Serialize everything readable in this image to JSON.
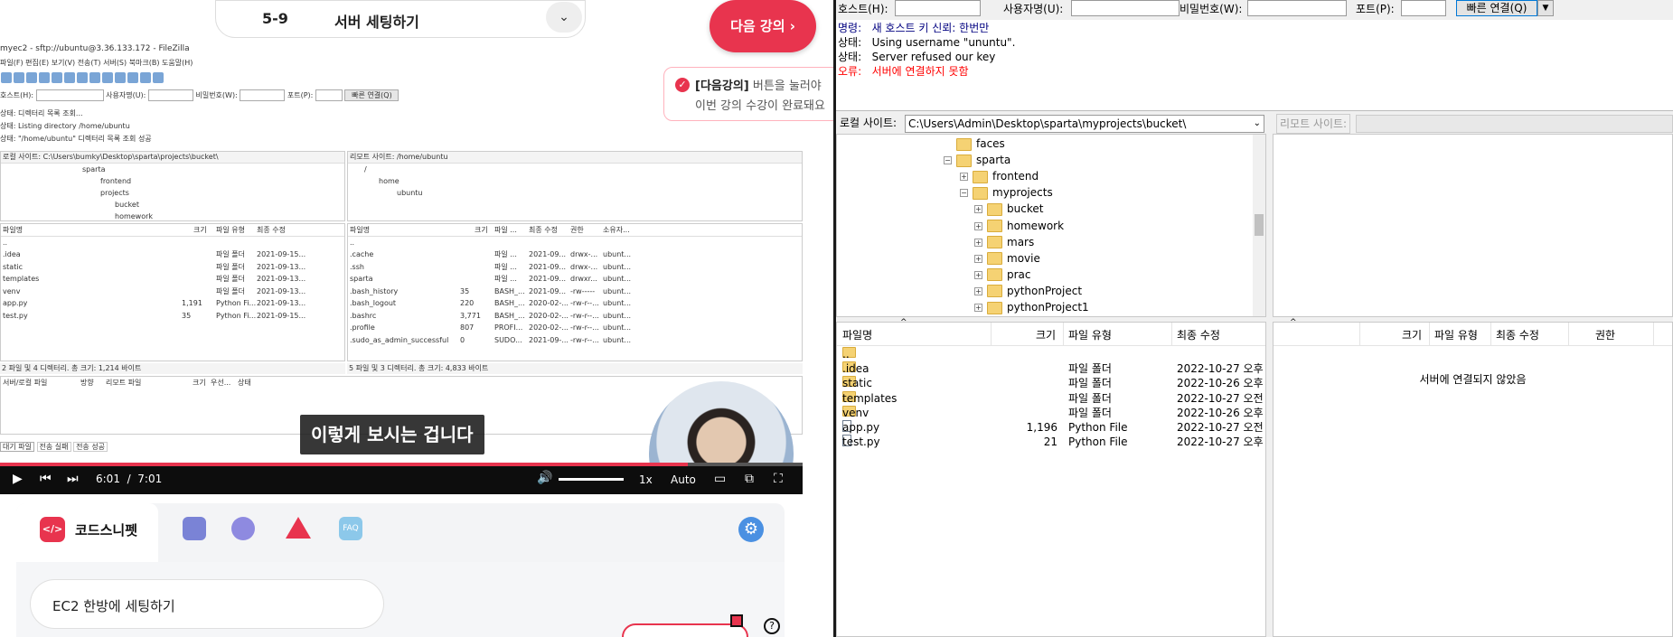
{
  "lecture": {
    "number": "5-9",
    "title": "서버 세팅하기",
    "next_button": "다음 강의",
    "toast_line1_bold": "[다음강의]",
    "toast_line1_rest": " 버튼을 눌러야",
    "toast_line2": "이번 강의 수강이 완료돼요"
  },
  "video": {
    "subtitle": "이렇게 보시는 겁니다",
    "current_time": "6:01",
    "separator": "/",
    "duration": "7:01",
    "progress_fraction": 0.857,
    "speed": "1x",
    "quality": "Auto"
  },
  "small_fz": {
    "title": "myec2 - sftp://ubuntu@3.36.133.172 - FileZilla",
    "menu": [
      "파일(F)",
      "편집(E)",
      "보기(V)",
      "전송(T)",
      "서버(S)",
      "북마크(B)",
      "도움말(H)"
    ],
    "qc_host": "호스트(H):",
    "qc_user": "사용자명(U):",
    "qc_pass": "비밀번호(W):",
    "qc_port": "포트(P):",
    "qc_connect": "빠른 연결(Q)",
    "log": [
      {
        "label": "상태:",
        "text": "디렉터리 목록 조회..."
      },
      {
        "label": "상태:",
        "text": "Listing directory /home/ubuntu"
      },
      {
        "label": "상태:",
        "text": "\"/home/ubuntu\" 디렉터리 목록 조회 성공"
      }
    ],
    "local_site_label": "로컬 사이트:",
    "local_site_path": "C:\\Users\\bumky\\Desktop\\sparta\\projects\\bucket\\",
    "remote_site_label": "리모트 사이트:",
    "remote_site_path": "/home/ubuntu",
    "local_tree": [
      "sparta",
      "frontend",
      "projects",
      "bucket",
      "homework"
    ],
    "remote_tree": [
      "/",
      "home",
      "ubuntu"
    ],
    "local_headers": [
      "파일명",
      "크기",
      "파일 유형",
      "최종 수정"
    ],
    "local_files": [
      {
        "name": "..",
        "size": "",
        "type": "",
        "date": ""
      },
      {
        "name": ".idea",
        "size": "",
        "type": "파일 폴더",
        "date": "2021-09-15..."
      },
      {
        "name": "static",
        "size": "",
        "type": "파일 폴더",
        "date": "2021-09-13..."
      },
      {
        "name": "templates",
        "size": "",
        "type": "파일 폴더",
        "date": "2021-09-13..."
      },
      {
        "name": "venv",
        "size": "",
        "type": "파일 폴더",
        "date": "2021-09-13..."
      },
      {
        "name": "app.py",
        "size": "1,191",
        "type": "Python Fi...",
        "date": "2021-09-13..."
      },
      {
        "name": "test.py",
        "size": "35",
        "type": "Python Fi...",
        "date": "2021-09-15..."
      }
    ],
    "remote_headers": [
      "파일명",
      "크기",
      "파일 ...",
      "최종 수정",
      "권한",
      "소유자..."
    ],
    "remote_files": [
      {
        "name": "..",
        "size": "",
        "type": "",
        "date": "",
        "perm": "",
        "owner": ""
      },
      {
        "name": ".cache",
        "size": "",
        "type": "파일 ...",
        "date": "2021-09...",
        "perm": "drwx-...",
        "owner": "ubunt..."
      },
      {
        "name": ".ssh",
        "size": "",
        "type": "파일 ...",
        "date": "2021-09...",
        "perm": "drwx-...",
        "owner": "ubunt..."
      },
      {
        "name": "sparta",
        "size": "",
        "type": "파일 ...",
        "date": "2021-09...",
        "perm": "drwxr...",
        "owner": "ubunt..."
      },
      {
        "name": ".bash_history",
        "size": "35",
        "type": "BASH_...",
        "date": "2021-09...",
        "perm": "-rw-----",
        "owner": "ubunt..."
      },
      {
        "name": ".bash_logout",
        "size": "220",
        "type": "BASH_...",
        "date": "2020-02-...",
        "perm": "-rw-r--...",
        "owner": "ubunt..."
      },
      {
        "name": ".bashrc",
        "size": "3,771",
        "type": "BASH_...",
        "date": "2020-02-...",
        "perm": "-rw-r--...",
        "owner": "ubunt..."
      },
      {
        "name": ".profile",
        "size": "807",
        "type": "PROFI...",
        "date": "2020-02-...",
        "perm": "-rw-r--...",
        "owner": "ubunt..."
      },
      {
        "name": ".sudo_as_admin_successful",
        "size": "0",
        "type": "SUDO...",
        "date": "2021-09-...",
        "perm": "-rw-r--...",
        "owner": "ubunt..."
      }
    ],
    "local_status": "2 파일 및 4 디렉터리. 총 크기: 1,214 바이트",
    "remote_status": "5 파일 및 3 디렉터리. 총 크기: 4,833 바이트",
    "queue_headers": [
      "서버/로컬 파일",
      "방향",
      "리모트 파일",
      "크기",
      "우선...",
      "상태"
    ],
    "queue_tabs": [
      "대기 파일",
      "전송 실패",
      "전송 성공"
    ]
  },
  "bottom": {
    "tab_label": "코드스니펫",
    "logo_text": "</>",
    "faq_label": "FAQ",
    "snippet_title": "EC2 한방에 세팅하기"
  },
  "right_fz": {
    "qc_host": "호스트(H):",
    "qc_user": "사용자명(U):",
    "qc_pass": "비밀번호(W):",
    "qc_port": "포트(P):",
    "qc_connect": "빠른 연결(Q)",
    "log": [
      {
        "label": "명령:",
        "text": "새 호스트 키 신뢰: 한번만",
        "color": "#000080"
      },
      {
        "label": "상태:",
        "text": "Using username \"ununtu\".",
        "color": "#000000"
      },
      {
        "label": "상태:",
        "text": "Server refused our key",
        "color": "#000000"
      },
      {
        "label": "오류:",
        "text": "서버에 연결하지 못함",
        "color": "#ff0000"
      }
    ],
    "local_site_label": "로컬 사이트:",
    "local_site_path": "C:\\Users\\Admin\\Desktop\\sparta\\myprojects\\bucket\\",
    "remote_site_label": "리모트 사이트:",
    "tree": [
      {
        "name": "faces",
        "level": 0,
        "expander": ""
      },
      {
        "name": "sparta",
        "level": 0,
        "expander": "−"
      },
      {
        "name": "frontend",
        "level": 1,
        "expander": "+"
      },
      {
        "name": "myprojects",
        "level": 1,
        "expander": "−"
      },
      {
        "name": "bucket",
        "level": 2,
        "expander": "+"
      },
      {
        "name": "homework",
        "level": 2,
        "expander": "+"
      },
      {
        "name": "mars",
        "level": 2,
        "expander": "+"
      },
      {
        "name": "movie",
        "level": 2,
        "expander": "+"
      },
      {
        "name": "prac",
        "level": 2,
        "expander": "+"
      },
      {
        "name": "pythonProject",
        "level": 2,
        "expander": "+"
      },
      {
        "name": "pythonProject1",
        "level": 2,
        "expander": "+"
      }
    ],
    "local_headers": [
      "파일명",
      "크기",
      "파일 유형",
      "최종 수정"
    ],
    "local_files": [
      {
        "name": "..",
        "size": "",
        "type": "",
        "date": "",
        "kind": "folder"
      },
      {
        "name": ".idea",
        "size": "",
        "type": "파일 폴더",
        "date": "2022-10-27 오후",
        "kind": "folder"
      },
      {
        "name": "static",
        "size": "",
        "type": "파일 폴더",
        "date": "2022-10-26 오후",
        "kind": "folder"
      },
      {
        "name": "templates",
        "size": "",
        "type": "파일 폴더",
        "date": "2022-10-27 오전",
        "kind": "folder"
      },
      {
        "name": "venv",
        "size": "",
        "type": "파일 폴더",
        "date": "2022-10-26 오후",
        "kind": "folder"
      },
      {
        "name": "app.py",
        "size": "1,196",
        "type": "Python File",
        "date": "2022-10-27 오전",
        "kind": "file"
      },
      {
        "name": "test.py",
        "size": "21",
        "type": "Python File",
        "date": "2022-10-27 오후",
        "kind": "file"
      }
    ],
    "remote_headers": [
      "크기",
      "파일 유형",
      "최종 수정",
      "권한"
    ],
    "remote_empty": "서버에 연결되지 않았음"
  },
  "colors": {
    "accent": "#e8344e",
    "gear": "#4a90e2",
    "log_command": "#000080",
    "log_error": "#ff0000"
  }
}
